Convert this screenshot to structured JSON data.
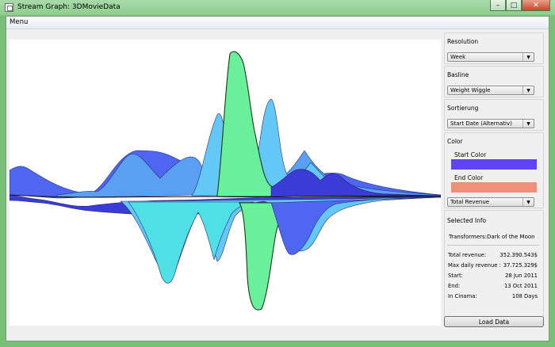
{
  "window": {
    "title": "Stream Graph: 3DMovieData",
    "minimize": "–",
    "maximize": "□",
    "close": "✕"
  },
  "menu": {
    "label": "Menu"
  },
  "controls": {
    "resolution_label": "Resolution",
    "resolution_value": "Week",
    "baseline_label": "Basline",
    "baseline_value": "Weight Wiggle",
    "sort_label": "Sortierung",
    "sort_value": "Start Date (Alternativ)",
    "color_label": "Color",
    "start_color_label": "Start Color",
    "start_color": "#5f43f5",
    "end_color_label": "End Color",
    "end_color": "#f0907a",
    "color_metric_value": "Total Revenue"
  },
  "selected_info": {
    "heading": "Selected Info",
    "name": "Transformers:Dark of the Moon",
    "rows": [
      {
        "label": "Total revenue:",
        "value": "352.390.543$"
      },
      {
        "label": "Max daily revenue :",
        "value": "37.725.329$"
      },
      {
        "label": "Start:",
        "value": "28 Jun 2011"
      },
      {
        "label": "End:",
        "value": "13 Oct 2011"
      },
      {
        "label": "In Cinama:",
        "value": "108 Days"
      }
    ]
  },
  "load_button": "Load Data",
  "icons": {
    "app": "window-app-icon",
    "dropdown": "chevron-down-icon"
  },
  "stream_colors": [
    "#4f67f0",
    "#5aa0f2",
    "#63c8f6",
    "#4fe0e6",
    "#6aef9a",
    "#3b3bd8"
  ],
  "highlight_color": "#6aef9a"
}
